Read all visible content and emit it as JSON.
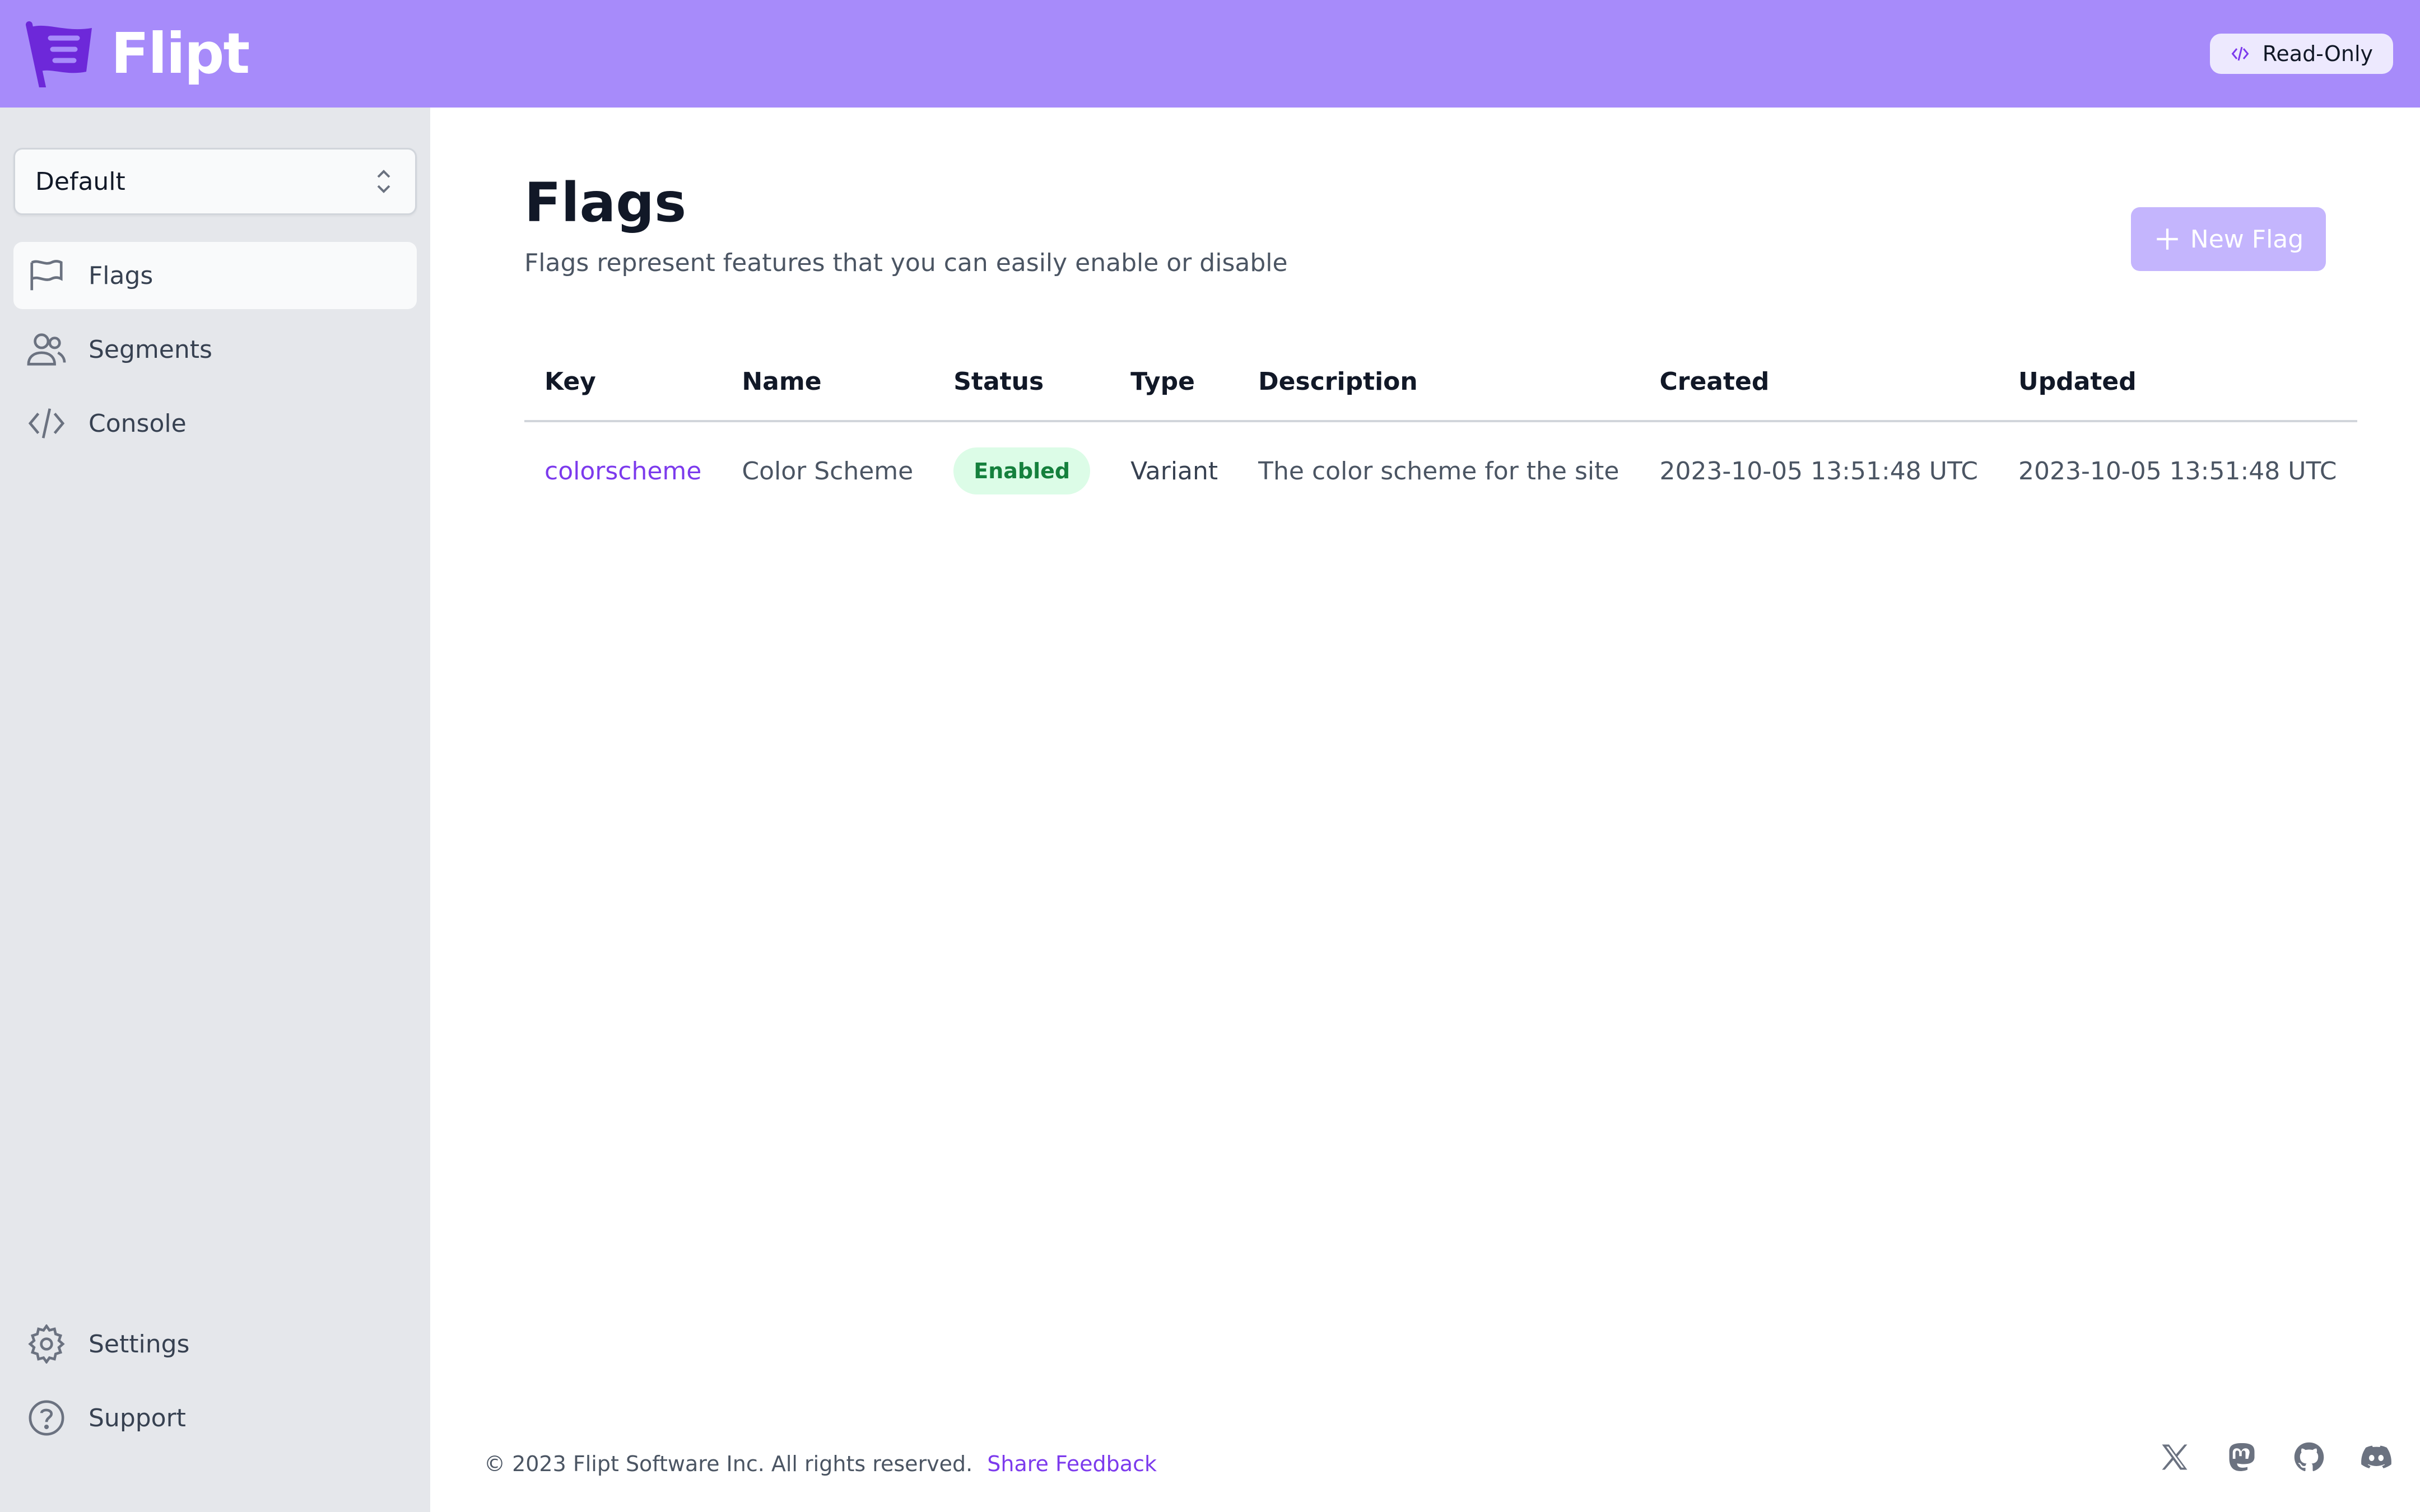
{
  "brand": {
    "name": "Flipt"
  },
  "header": {
    "readonly_label": "Read-Only"
  },
  "sidebar": {
    "namespace_select": "Default",
    "items": [
      {
        "label": "Flags",
        "icon": "flag-icon",
        "active": true
      },
      {
        "label": "Segments",
        "icon": "users-icon",
        "active": false
      },
      {
        "label": "Console",
        "icon": "code-icon",
        "active": false
      }
    ],
    "bottom_items": [
      {
        "label": "Settings",
        "icon": "gear-icon"
      },
      {
        "label": "Support",
        "icon": "question-icon"
      }
    ]
  },
  "page": {
    "title": "Flags",
    "subtitle": "Flags represent features that you can easily enable or disable",
    "new_button": "New Flag"
  },
  "table": {
    "columns": [
      "Key",
      "Name",
      "Status",
      "Type",
      "Description",
      "Created",
      "Updated"
    ],
    "rows": [
      {
        "key": "colorscheme",
        "name": "Color Scheme",
        "status": "Enabled",
        "type": "Variant",
        "description": "The color scheme for the site",
        "created": "2023-10-05 13:51:48 UTC",
        "updated": "2023-10-05 13:51:48 UTC"
      }
    ]
  },
  "footer": {
    "copyright": "© 2023 Flipt Software Inc. All rights reserved.",
    "feedback_link": "Share Feedback",
    "social_icons": [
      "x-icon",
      "mastodon-icon",
      "github-icon",
      "discord-icon"
    ]
  },
  "colors": {
    "header_bg": "#a78bfa",
    "accent": "#7c3aed",
    "sidebar_bg": "#e5e7eb",
    "status_enabled_bg": "#dcfce7",
    "status_enabled_fg": "#15803d"
  }
}
